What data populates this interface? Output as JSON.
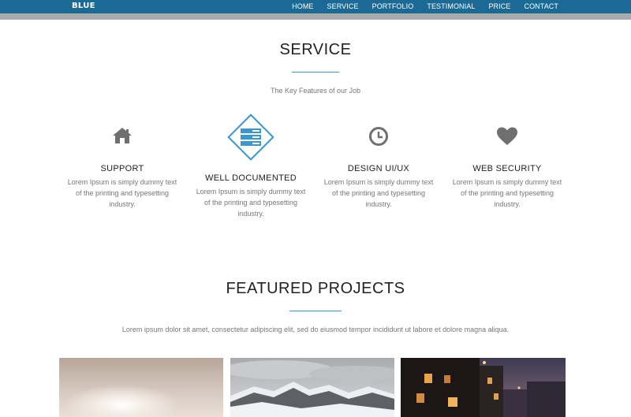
{
  "brand": "BLUE",
  "nav": {
    "items": [
      "HOME",
      "SERVICE",
      "PORTFOLIO",
      "TESTIMONIAL",
      "PRICE",
      "CONTACT"
    ]
  },
  "service": {
    "title": "SERVICE",
    "subtitle": "The Key Features of our Job",
    "items": [
      {
        "icon": "home-icon",
        "title": "SUPPORT",
        "text_lines": [
          "Lorem Ipsum is simply dummy text",
          "of the printing and typesetting",
          "industry."
        ]
      },
      {
        "icon": "server-icon",
        "title": "WELL DOCUMENTED",
        "text_lines": [
          "Lorem Ipsum is simply dummy text",
          "of the printing and typesetting",
          "industry."
        ]
      },
      {
        "icon": "clock-icon",
        "title": "DESIGN UI/UX",
        "text_lines": [
          "Lorem Ipsum is simply dummy text",
          "of the printing and typesetting",
          "industry."
        ]
      },
      {
        "icon": "heart-icon",
        "title": "WEB SECURITY",
        "text_lines": [
          "Lorem Ipsum is simply dummy text",
          "of the printing and typesetting",
          "industry."
        ]
      }
    ]
  },
  "projects": {
    "title": "FEATURED PROJECTS",
    "subtitle": "Lorem ipsum dolor sit amet, consectetur adipiscing elit, sed do eiusmod tempor incididunt ut labore et dolore magna aliqua."
  },
  "colors": {
    "nav_bg": "#1b6a96",
    "accent": "#3a96cf",
    "icon_gray": "#6f6f6f"
  }
}
